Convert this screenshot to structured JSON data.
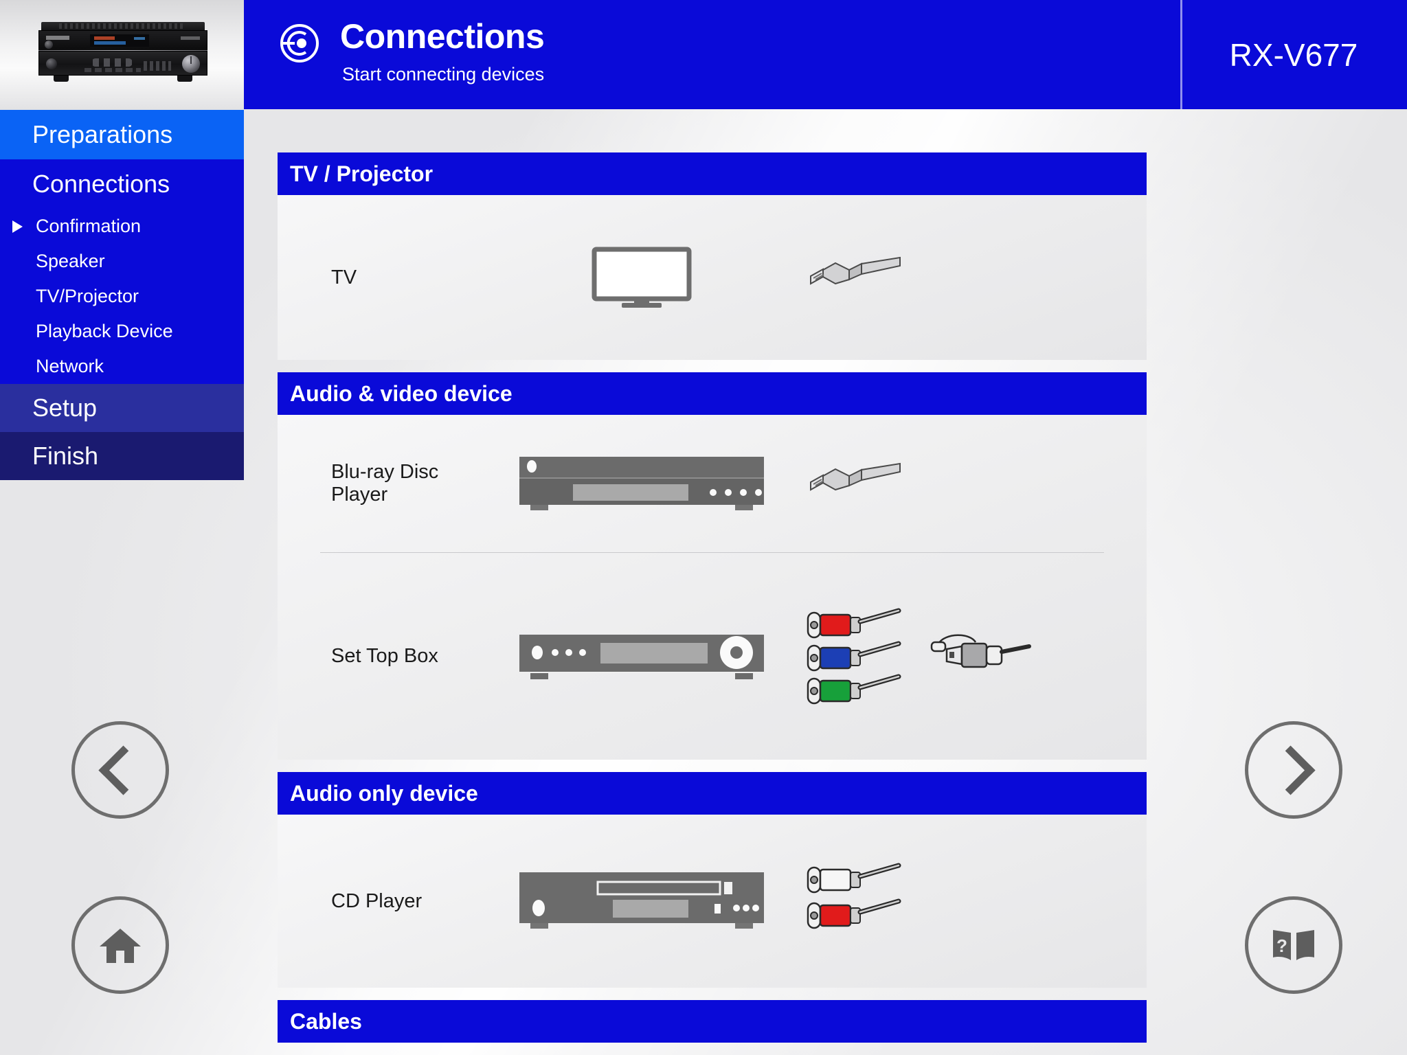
{
  "header": {
    "icon": "connection-plug-icon",
    "title": "Connections",
    "subtitle": "Start connecting devices",
    "model": "RX-V677",
    "bg_color": "#0a0ad8"
  },
  "sidebar": {
    "product_image_alt": "AV receiver front panel",
    "items": [
      {
        "label": "Preparations",
        "level": "top",
        "state": "completed",
        "color": "#0a63f5"
      },
      {
        "label": "Connections",
        "level": "section",
        "state": "active",
        "color": "#0a0ad8"
      },
      {
        "label": "Confirmation",
        "level": "sub",
        "state": "current",
        "marker": "triangle-right-icon"
      },
      {
        "label": "Speaker",
        "level": "sub",
        "state": "pending"
      },
      {
        "label": "TV/Projector",
        "level": "sub",
        "state": "pending"
      },
      {
        "label": "Playback Device",
        "level": "sub",
        "state": "pending"
      },
      {
        "label": "Network",
        "level": "sub",
        "state": "pending"
      },
      {
        "label": "Setup",
        "level": "top",
        "state": "pending",
        "color": "#2a2f9e"
      },
      {
        "label": "Finish",
        "level": "top",
        "state": "pending",
        "color": "#1a1a70"
      }
    ]
  },
  "main": {
    "sections": [
      {
        "title": "TV / Projector",
        "rows": [
          {
            "device": "TV",
            "device_icon": "tv-monitor-icon",
            "cables": [
              "hdmi-cable-icon"
            ]
          }
        ]
      },
      {
        "title": "Audio & video device",
        "rows": [
          {
            "device": "Blu-ray Disc Player",
            "device_icon": "bluray-player-icon",
            "cables": [
              "hdmi-cable-icon"
            ]
          },
          {
            "device": "Set Top Box",
            "device_icon": "set-top-box-icon",
            "cables": [
              "rca-red-cable-icon",
              "rca-blue-cable-icon",
              "rca-green-cable-icon",
              "optical-toslink-cable-icon"
            ]
          }
        ]
      },
      {
        "title": "Audio only device",
        "rows": [
          {
            "device": "CD Player",
            "device_icon": "cd-player-icon",
            "cables": [
              "rca-white-cable-icon",
              "rca-red-cable-icon"
            ]
          }
        ]
      },
      {
        "title": "Cables",
        "rows": []
      }
    ]
  },
  "nav_buttons": {
    "prev": {
      "name": "previous-page-button",
      "icon": "chevron-left-icon"
    },
    "home": {
      "name": "home-button",
      "icon": "home-icon"
    },
    "next": {
      "name": "next-page-button",
      "icon": "chevron-right-icon"
    },
    "help": {
      "name": "manual-help-button",
      "icon": "book-question-icon"
    }
  },
  "colors": {
    "brand_blue": "#0a0ad8",
    "active_blue": "#0a63f5",
    "setup_blue": "#2a2f9e",
    "finish_navy": "#1a1a70",
    "page_bg": "#e9e9ea",
    "rca_red": "#e11b1b",
    "rca_blue": "#1c3fb5",
    "rca_green": "#17a03a",
    "rca_white": "#f2f2f2",
    "device_gray": "#6b6b6b"
  }
}
